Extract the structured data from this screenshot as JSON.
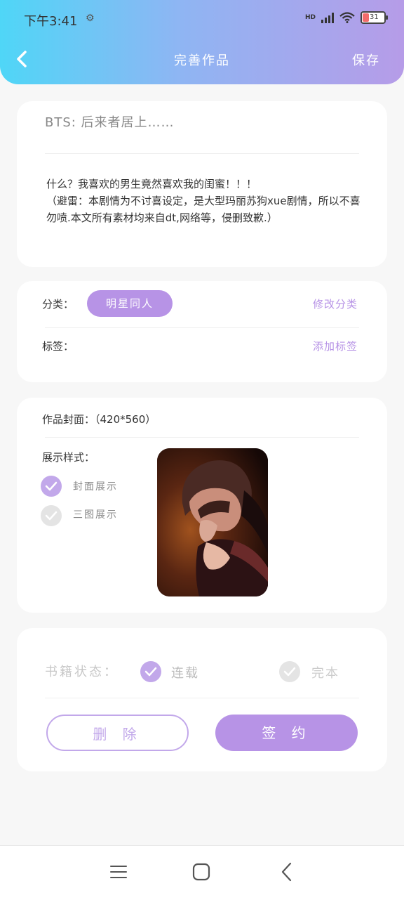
{
  "status_bar": {
    "time": "下午3:41",
    "network": "HD",
    "battery": "31"
  },
  "header": {
    "title": "完善作品",
    "save_label": "保存"
  },
  "work": {
    "title": "BTS: 后来者居上……",
    "description": "什么？我喜欢的男生竟然喜欢我的闺蜜！！！\n（避雷：本剧情为不讨喜设定，是大型玛丽苏狗xue剧情，所以不喜勿喷.本文所有素材均来自dt,网络等，侵删致歉.）"
  },
  "category": {
    "label": "分类：",
    "value": "明星同人",
    "edit_label": "修改分类"
  },
  "tags": {
    "label": "标签：",
    "add_label": "添加标签"
  },
  "cover": {
    "label": "作品封面：（420*560）",
    "style_label": "展示样式：",
    "options": [
      {
        "label": "封面展示",
        "selected": true
      },
      {
        "label": "三图展示",
        "selected": false
      }
    ]
  },
  "book_status": {
    "label": "书籍状态：",
    "options": [
      {
        "label": "连载",
        "selected": true
      },
      {
        "label": "完本",
        "selected": false
      }
    ]
  },
  "actions": {
    "delete_label": "删 除",
    "sign_label": "签 约"
  },
  "colors": {
    "accent": "#b793e6",
    "header_start": "#4fd6f7",
    "header_end": "#b69ce8"
  },
  "nav": {
    "items": [
      "menu-icon",
      "home-icon",
      "back-icon"
    ]
  }
}
